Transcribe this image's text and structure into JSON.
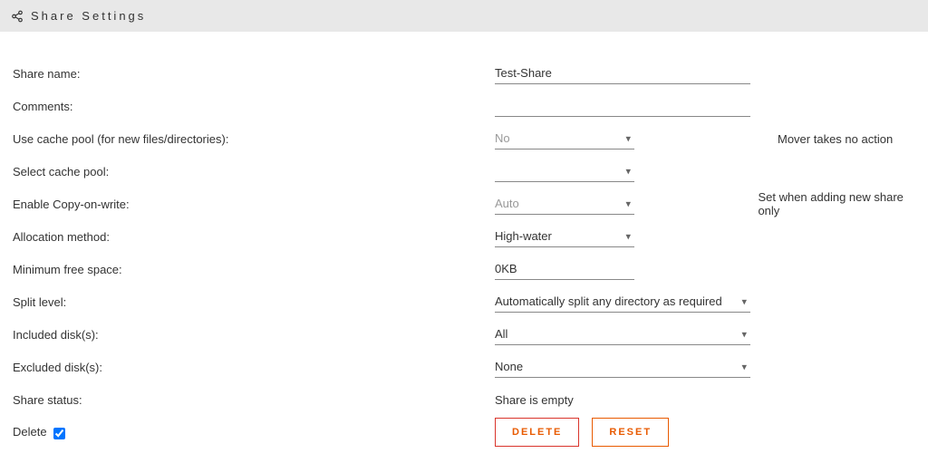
{
  "header": {
    "title": "Share Settings"
  },
  "fields": {
    "share_name": {
      "label": "Share name:",
      "value": "Test-Share"
    },
    "comments": {
      "label": "Comments:",
      "value": ""
    },
    "use_cache": {
      "label": "Use cache pool (for new files/directories):",
      "value": "No",
      "note": "Mover takes no action"
    },
    "select_cache": {
      "label": "Select cache pool:",
      "value": ""
    },
    "cow": {
      "label": "Enable Copy-on-write:",
      "value": "Auto",
      "note": "Set when adding new share only"
    },
    "allocation": {
      "label": "Allocation method:",
      "value": "High-water"
    },
    "min_free": {
      "label": "Minimum free space:",
      "value": "0KB"
    },
    "split": {
      "label": "Split level:",
      "value": "Automatically split any directory as required"
    },
    "included": {
      "label": "Included disk(s):",
      "value": "All"
    },
    "excluded": {
      "label": "Excluded disk(s):",
      "value": "None"
    },
    "status": {
      "label": "Share status:",
      "value": "Share is empty"
    },
    "delete": {
      "label": "Delete"
    }
  },
  "buttons": {
    "delete": "DELETE",
    "reset": "RESET"
  }
}
